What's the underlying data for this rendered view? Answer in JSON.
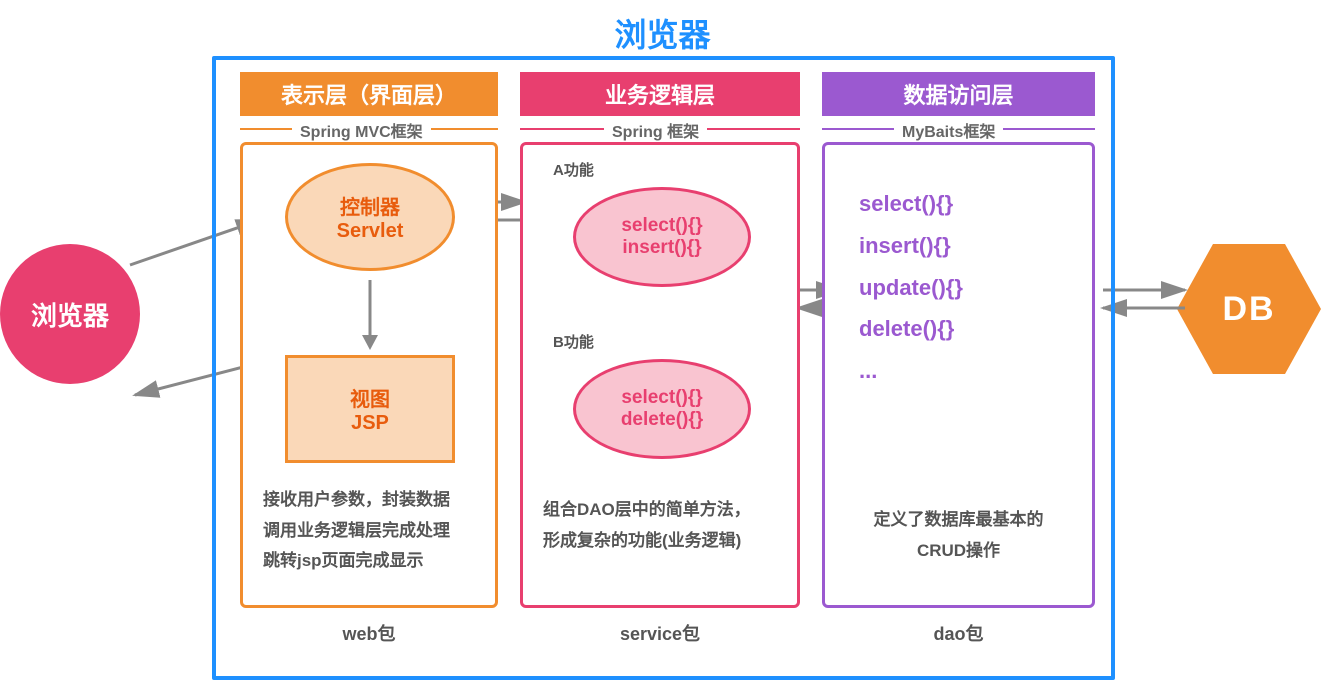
{
  "title": "浏览器",
  "browser_node": "浏览器",
  "db_node": "DB",
  "columns": {
    "presentation": {
      "header": "表示层（界面层）",
      "framework": "Spring MVC框架",
      "controller": {
        "name": "控制器",
        "tech": "Servlet"
      },
      "view": {
        "name": "视图",
        "tech": "JSP"
      },
      "desc_line1": "接收用户参数，封装数据",
      "desc_line2": "调用业务逻辑层完成处理",
      "desc_line3": "跳转jsp页面完成显示",
      "package": "web包"
    },
    "business": {
      "header": "业务逻辑层",
      "framework": "Spring 框架",
      "func_a_label": "A功能",
      "func_a_line1": "select(){}",
      "func_a_line2": "insert(){}",
      "func_b_label": "B功能",
      "func_b_line1": "select(){}",
      "func_b_line2": "delete(){}",
      "desc_line1": "组合DAO层中的简单方法，",
      "desc_line2": "形成复杂的功能(业务逻辑)",
      "package": "service包"
    },
    "data": {
      "header": "数据访问层",
      "framework": "MyBaits框架",
      "crud": [
        "select(){}",
        "insert(){}",
        "update(){}",
        "delete(){}",
        "..."
      ],
      "desc_line1": "定义了数据库最基本的",
      "desc_line2": "CRUD操作",
      "package": "dao包"
    }
  }
}
